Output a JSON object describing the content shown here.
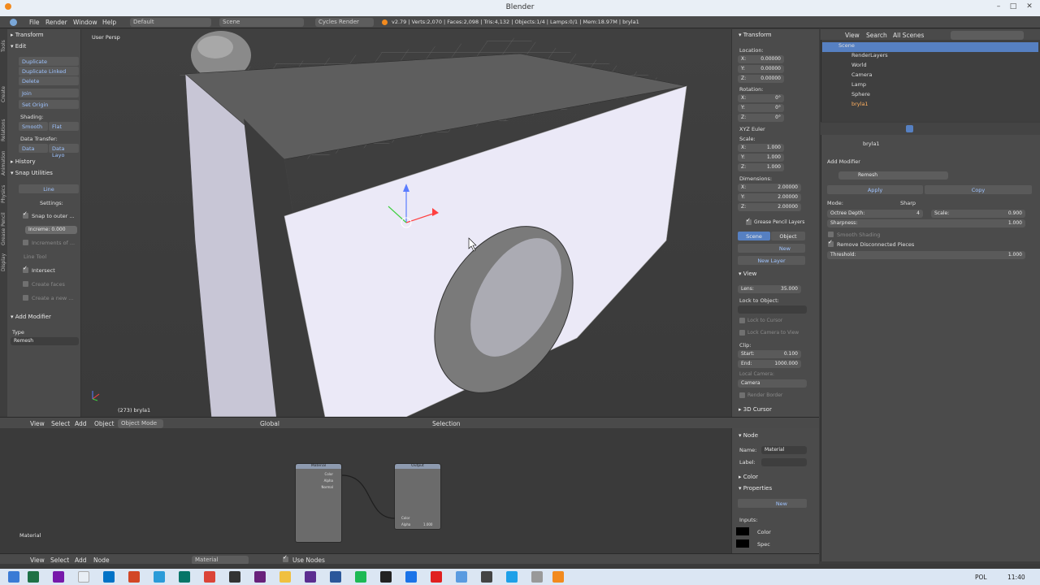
{
  "window": {
    "title": "Blender"
  },
  "info_header": {
    "menus": [
      "File",
      "Render",
      "Window",
      "Help"
    ],
    "layout": "Default",
    "scene": "Scene",
    "engine": "Cycles Render",
    "stats": "v2.79 | Verts:2,070 | Faces:2,098 | Tris:4,132 | Objects:1/4 | Lamps:0/1 | Mem:18.97M | bryla1"
  },
  "toolshelf": {
    "tabs": [
      "Tools",
      "Create",
      "Relations",
      "Animation",
      "Physics",
      "Grease Pencil",
      "Display"
    ],
    "transform_label": "Transform",
    "edit_label": "Edit",
    "buttons": [
      "Duplicate",
      "Duplicate Linked",
      "Delete",
      "Join",
      "Set Origin"
    ],
    "shading_label": "Shading:",
    "smooth": "Smooth",
    "flat": "Flat",
    "data_transfer_label": "Data Transfer:",
    "data": "Data",
    "data_layo": "Data Layo",
    "history_label": "History",
    "snap_label": "Snap Utilities",
    "line": "Line",
    "settings": "Settings:",
    "snap_to_outer": "Snap to outer ...",
    "increment": "Increme: 0.000",
    "increments_of": "Increments of ...",
    "line_tool": "Line Tool",
    "intersect": "Intersect",
    "create_faces": "Create faces",
    "create_new": "Create a new ...",
    "add_modifier_label": "Add Modifier",
    "type_label": "Type",
    "type_value": "Remesh"
  },
  "viewport": {
    "view_name": "User Persp",
    "object_label": "(273) bryla1"
  },
  "npanel": {
    "transform_label": "Transform",
    "location_label": "Location:",
    "location": [
      [
        "X:",
        "0.00000"
      ],
      [
        "Y:",
        "0.00000"
      ],
      [
        "Z:",
        "0.00000"
      ]
    ],
    "rotation_label": "Rotation:",
    "rotation": [
      [
        "X:",
        "0°"
      ],
      [
        "Y:",
        "0°"
      ],
      [
        "Z:",
        "0°"
      ]
    ],
    "rotation_mode": "XYZ Euler",
    "scale_label": "Scale:",
    "scale": [
      [
        "X:",
        "1.000"
      ],
      [
        "Y:",
        "1.000"
      ],
      [
        "Z:",
        "1.000"
      ]
    ],
    "dimensions_label": "Dimensions:",
    "dimensions": [
      [
        "X:",
        "2.00000"
      ],
      [
        "Y:",
        "2.00000"
      ],
      [
        "Z:",
        "2.00000"
      ]
    ],
    "gp_layers": "Grease Pencil Layers",
    "scene_tab": "Scene",
    "object_tab": "Object",
    "new": "New",
    "new_layer": "New Layer",
    "view_label": "View",
    "lens": "Lens:",
    "lens_value": "35.000",
    "lock_to_object": "Lock to Object:",
    "lock_to_cursor": "Lock to Cursor",
    "lock_camera": "Lock Camera to View",
    "clip_label": "Clip:",
    "start": "Start:",
    "start_value": "0.100",
    "end": "End:",
    "end_value": "1000.000",
    "local_camera": "Local Camera:",
    "camera": "Camera",
    "render_border": "Render Border",
    "cursor_label": "3D Cursor"
  },
  "outliner": {
    "menus": [
      "View",
      "Search"
    ],
    "filter": "All Scenes",
    "items": [
      "Scene",
      "RenderLayers",
      "World",
      "Camera",
      "Lamp",
      "Sphere",
      "bryla1"
    ]
  },
  "properties": {
    "object_name": "bryla1",
    "add_modifier": "Add Modifier",
    "modifier_name": "Remesh",
    "apply": "Apply",
    "copy": "Copy",
    "mode_label": "Mode:",
    "mode_value": "Sharp",
    "octree_depth": "Octree Depth:",
    "octree_value": "4",
    "scale_label": "Scale:",
    "scale_value": "0.900",
    "sharpness": "Sharpness:",
    "sharpness_value": "1.000",
    "smooth_shading": "Smooth Shading",
    "remove_disconnected": "Remove Disconnected Pieces",
    "threshold": "Threshold:",
    "threshold_value": "1.000"
  },
  "viewport_header": {
    "menus": [
      "View",
      "Select",
      "Add",
      "Object"
    ],
    "mode": "Object Mode",
    "orientation": "Global",
    "selection": "Selection"
  },
  "node_editor": {
    "material_label": "Material",
    "menus": [
      "View",
      "Select",
      "Add",
      "Node"
    ],
    "material": "Material",
    "use_nodes": "Use Nodes",
    "node1_title": "Material",
    "node1_outputs": [
      "Color",
      "Alpha",
      "Normal"
    ],
    "node2_title": "Output",
    "node2_inputs": [
      "Color",
      "Alpha",
      "1.000"
    ]
  },
  "node_panel": {
    "node_label": "Node",
    "name_label": "Name:",
    "name_value": "Material",
    "label_label": "Label:",
    "color_label": "Color",
    "properties_label": "Properties",
    "new": "New",
    "inputs_label": "Inputs:",
    "inputs": [
      "Color",
      "Spec"
    ]
  },
  "taskbar": {
    "language": "POL",
    "time": "11:40"
  },
  "colors": {
    "accent_blue": "#5680c2",
    "selection_orange": "#f28a1e"
  }
}
